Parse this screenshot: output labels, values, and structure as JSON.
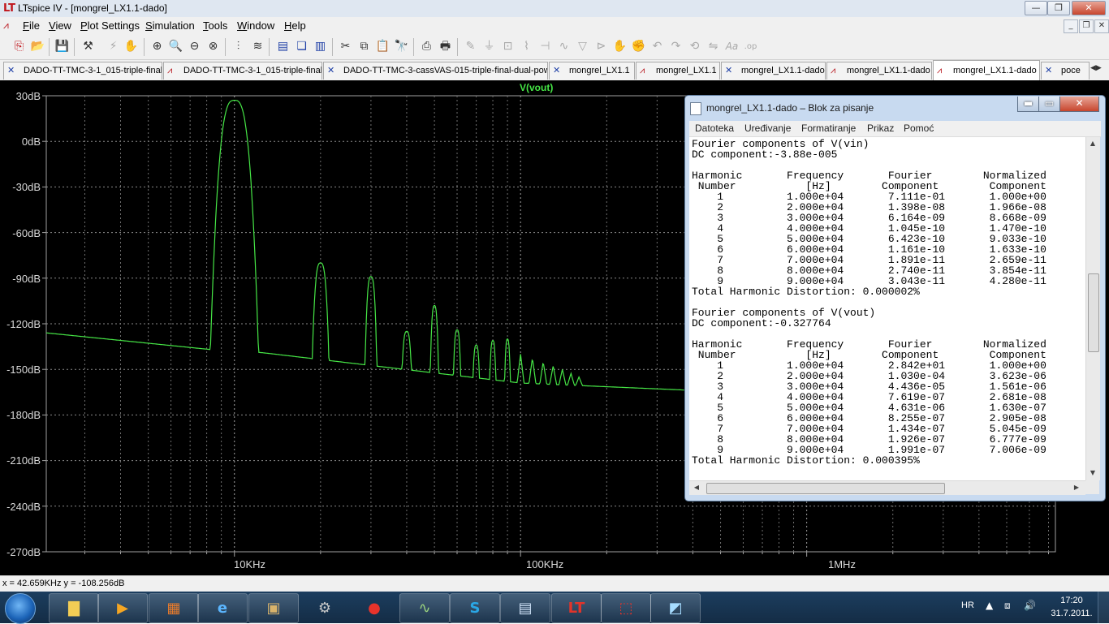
{
  "window": {
    "title": "LTspice IV - [mongrel_LX1.1-dado]"
  },
  "menubar": {
    "items": [
      "File",
      "View",
      "Plot Settings",
      "Simulation",
      "Tools",
      "Window",
      "Help"
    ]
  },
  "tabs": [
    {
      "label": "DADO-TT-TMC-3-1_015-triple-final",
      "kind": "schematic"
    },
    {
      "label": "DADO-TT-TMC-3-1_015-triple-final",
      "kind": "waveform"
    },
    {
      "label": "DADO-TT-TMC-3-cassVAS-015-triple-final-dual-pow",
      "kind": "schematic"
    },
    {
      "label": "mongrel_LX1.1",
      "kind": "schematic"
    },
    {
      "label": "mongrel_LX1.1",
      "kind": "waveform"
    },
    {
      "label": "mongrel_LX1.1-dado",
      "kind": "schematic"
    },
    {
      "label": "mongrel_LX1.1-dado",
      "kind": "waveform"
    },
    {
      "label": "mongrel_LX1.1-dado",
      "kind": "waveform",
      "active": true
    },
    {
      "label": "poce",
      "kind": "schematic"
    }
  ],
  "plot": {
    "trace_name": "V(vout)",
    "trace_color": "#46e646",
    "y_labels": [
      "30dB",
      "0dB",
      "-30dB",
      "-60dB",
      "-90dB",
      "-120dB",
      "-150dB",
      "-180dB",
      "-210dB",
      "-240dB",
      "-270dB"
    ],
    "x_labels": [
      "10KHz",
      "100KHz",
      "1MHz"
    ]
  },
  "chart_data": {
    "type": "line",
    "title": "",
    "series": [
      {
        "name": "V(vout)"
      }
    ],
    "xlabel": "",
    "ylabel": "",
    "x_scale": "log",
    "x_range_hz": [
      2200,
      7400000
    ],
    "ylim": [
      -270,
      30
    ],
    "y_unit": "dB",
    "grid": true,
    "peaks": [
      {
        "freq_hz": 10000,
        "db": 27
      },
      {
        "freq_hz": 20000,
        "db": -80
      },
      {
        "freq_hz": 30000,
        "db": -89
      },
      {
        "freq_hz": 40000,
        "db": -125
      },
      {
        "freq_hz": 50000,
        "db": -108
      },
      {
        "freq_hz": 60000,
        "db": -124
      },
      {
        "freq_hz": 70000,
        "db": -134
      },
      {
        "freq_hz": 80000,
        "db": -131
      },
      {
        "freq_hz": 90000,
        "db": -130
      }
    ],
    "noise_floor": [
      {
        "freq_hz": 2200,
        "db": -126
      },
      {
        "freq_hz": 8300,
        "db": -137
      },
      {
        "freq_hz": 12500,
        "db": -139
      },
      {
        "freq_hz": 100000,
        "db": -159
      },
      {
        "freq_hz": 1000000,
        "db": -167
      },
      {
        "freq_hz": 7400000,
        "db": -171
      }
    ]
  },
  "statusbar": {
    "cursor": "x = 42.659KHz   y = -108.256dB"
  },
  "notepad": {
    "title": "mongrel_LX1.1-dado – Blok za pisanje",
    "menu": [
      "Datoteka",
      "Uređivanje",
      "Formatiranje",
      "Prikaz",
      "Pomoć"
    ],
    "lines": [
      "Fourier components of V(vin)",
      "DC component:-3.88e-005",
      "",
      "Harmonic       Frequency       Fourier        Normalized",
      " Number           [Hz]        Component        Component",
      "    1          1.000e+04       7.111e-01       1.000e+00",
      "    2          2.000e+04       1.398e-08       1.966e-08",
      "    3          3.000e+04       6.164e-09       8.668e-09",
      "    4          4.000e+04       1.045e-10       1.470e-10",
      "    5          5.000e+04       6.423e-10       9.033e-10",
      "    6          6.000e+04       1.161e-10       1.633e-10",
      "    7          7.000e+04       1.891e-11       2.659e-11",
      "    8          8.000e+04       2.740e-11       3.854e-11",
      "    9          9.000e+04       3.043e-11       4.280e-11",
      "Total Harmonic Distortion: 0.000002%",
      "",
      "Fourier components of V(vout)",
      "DC component:-0.327764",
      "",
      "Harmonic       Frequency       Fourier        Normalized",
      " Number           [Hz]        Component        Component",
      "    1          1.000e+04       2.842e+01       1.000e+00",
      "    2          2.000e+04       1.030e-04       3.623e-06",
      "    3          3.000e+04       4.436e-05       1.561e-06",
      "    4          4.000e+04       7.619e-07       2.681e-08",
      "    5          5.000e+04       4.631e-06       1.630e-07",
      "    6          6.000e+04       8.255e-07       2.905e-08",
      "    7          7.000e+04       1.434e-07       5.045e-09",
      "    8          8.000e+04       1.926e-07       6.777e-09",
      "    9          9.000e+04       1.991e-07       7.006e-09",
      "Total Harmonic Distortion: 0.000395%"
    ]
  },
  "taskbar": {
    "language": "HR",
    "time": "17:20",
    "date": "31.7.2011."
  }
}
